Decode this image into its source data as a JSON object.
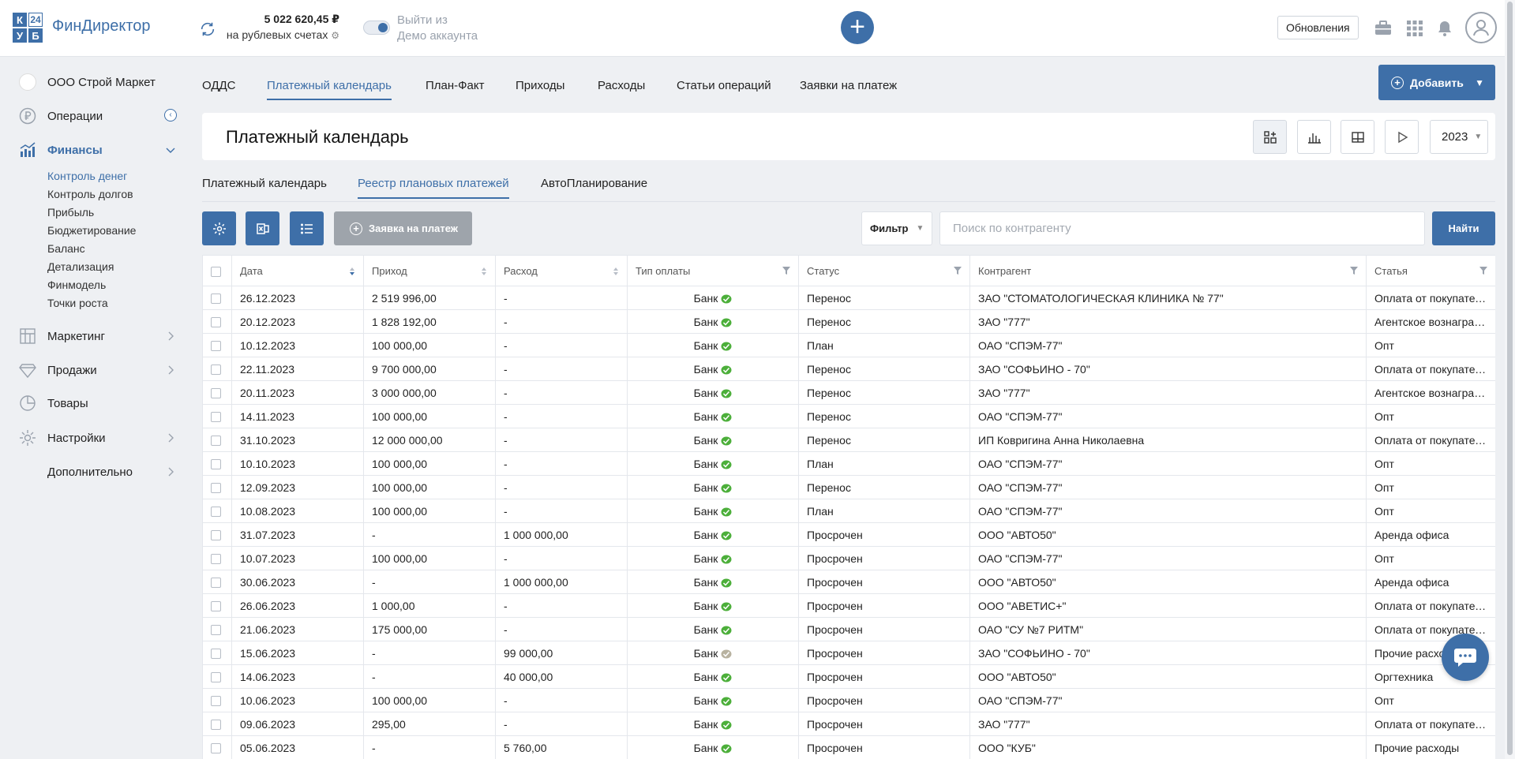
{
  "header": {
    "logo_cells": [
      "К",
      "24",
      "У",
      "Б"
    ],
    "app_title": "ФинДиректор",
    "balance_amount": "5 022 620,45 ₽",
    "balance_sub": "на рублевых счетах",
    "demo_line1": "Выйти из",
    "demo_line2": "Демо аккаунта",
    "updates_label": "Обновления",
    "add_symbol": "+"
  },
  "sidebar": {
    "company": "ООО Строй Маркет",
    "items": [
      {
        "label": "Операции",
        "icon": "ruble-icon"
      },
      {
        "label": "Финансы",
        "icon": "chart-icon",
        "active": true
      },
      {
        "label": "Маркетинг",
        "icon": "grid-icon"
      },
      {
        "label": "Продажи",
        "icon": "diamond-icon"
      },
      {
        "label": "Товары",
        "icon": "pie-icon"
      },
      {
        "label": "Настройки",
        "icon": "gear-icon"
      },
      {
        "label": "Дополнительно",
        "icon": ""
      }
    ],
    "finance_sub": [
      "Контроль денег",
      "Контроль долгов",
      "Прибыль",
      "Бюджетирование",
      "Баланс",
      "Детализация",
      "Финмодель",
      "Точки роста"
    ]
  },
  "tabs": [
    "ОДДС",
    "Платежный календарь",
    "План-Факт",
    "Приходы",
    "Расходы",
    "Статьи операций",
    "Заявки на платеж"
  ],
  "add_button": "Добавить",
  "page_title": "Платежный календарь",
  "year": "2023",
  "sub_tabs": [
    "Платежный календарь",
    "Реестр плановых платежей",
    "АвтоПланирование"
  ],
  "toolbar": {
    "request_label": "Заявка на платеж",
    "filter_label": "Фильтр",
    "search_placeholder": "Поиск по контрагенту",
    "find_label": "Найти"
  },
  "table": {
    "columns": [
      "Дата",
      "Приход",
      "Расход",
      "Тип оплаты",
      "Статус",
      "Контрагент",
      "Статья"
    ],
    "rows": [
      [
        "26.12.2023",
        "2 519 996,00",
        "-",
        "Банк",
        "Перенос",
        "ЗАО \"СТОМАТОЛОГИЧЕСКАЯ КЛИНИКА № 77\"",
        "Оплата от покупателей"
      ],
      [
        "20.12.2023",
        "1 828 192,00",
        "-",
        "Банк",
        "Перенос",
        "ЗАО \"777\"",
        "Агентское вознаграждение"
      ],
      [
        "10.12.2023",
        "100 000,00",
        "-",
        "Банк",
        "План",
        "ОАО \"СПЭМ-77\"",
        "Опт"
      ],
      [
        "22.11.2023",
        "9 700 000,00",
        "-",
        "Банк",
        "Перенос",
        "ЗАО \"СОФЬИНО - 70\"",
        "Оплата от покупателей"
      ],
      [
        "20.11.2023",
        "3 000 000,00",
        "-",
        "Банк",
        "Перенос",
        "ЗАО \"777\"",
        "Агентское вознаграждение"
      ],
      [
        "14.11.2023",
        "100 000,00",
        "-",
        "Банк",
        "Перенос",
        "ОАО \"СПЭМ-77\"",
        "Опт"
      ],
      [
        "31.10.2023",
        "12 000 000,00",
        "-",
        "Банк",
        "Перенос",
        "ИП Ковригина Анна Николаевна",
        "Оплата от покупателей"
      ],
      [
        "10.10.2023",
        "100 000,00",
        "-",
        "Банк",
        "План",
        "ОАО \"СПЭМ-77\"",
        "Опт"
      ],
      [
        "12.09.2023",
        "100 000,00",
        "-",
        "Банк",
        "Перенос",
        "ОАО \"СПЭМ-77\"",
        "Опт"
      ],
      [
        "10.08.2023",
        "100 000,00",
        "-",
        "Банк",
        "План",
        "ОАО \"СПЭМ-77\"",
        "Опт"
      ],
      [
        "31.07.2023",
        "-",
        "1 000 000,00",
        "Банк",
        "Просрочен",
        "ООО \"АВТО50\"",
        "Аренда офиса"
      ],
      [
        "10.07.2023",
        "100 000,00",
        "-",
        "Банк",
        "Просрочен",
        "ОАО \"СПЭМ-77\"",
        "Опт"
      ],
      [
        "30.06.2023",
        "-",
        "1 000 000,00",
        "Банк",
        "Просрочен",
        "ООО \"АВТО50\"",
        "Аренда офиса"
      ],
      [
        "26.06.2023",
        "1 000,00",
        "-",
        "Банк",
        "Просрочен",
        "ООО \"АВЕТИС+\"",
        "Оплата от покупателей"
      ],
      [
        "21.06.2023",
        "175 000,00",
        "-",
        "Банк",
        "Просрочен",
        "ОАО \"СУ №7 РИТМ\"",
        "Оплата от покупателей"
      ],
      [
        "15.06.2023",
        "-",
        "99 000,00",
        "Банк",
        "Просрочен",
        "ЗАО \"СОФЬИНО - 70\"",
        "Прочие расходы"
      ],
      [
        "14.06.2023",
        "-",
        "40 000,00",
        "Банк",
        "Просрочен",
        "ООО \"АВТО50\"",
        "Оргтехника"
      ],
      [
        "10.06.2023",
        "100 000,00",
        "-",
        "Банк",
        "Просрочен",
        "ОАО \"СПЭМ-77\"",
        "Опт"
      ],
      [
        "09.06.2023",
        "295,00",
        "-",
        "Банк",
        "Просрочен",
        "ЗАО \"777\"",
        "Оплата от покупателей"
      ],
      [
        "05.06.2023",
        "-",
        "5 760,00",
        "Банк",
        "Просрочен",
        "ООО \"КУБ\"",
        "Прочие расходы"
      ]
    ],
    "pay_icon_colors": [
      "green",
      "green",
      "green",
      "green",
      "green",
      "green",
      "green",
      "green",
      "green",
      "green",
      "green",
      "green",
      "green",
      "green",
      "green",
      "grey",
      "green",
      "green",
      "green",
      "green"
    ]
  },
  "colors": {
    "accent": "#3e6fa8",
    "pay_green": "#4caf3a",
    "pay_grey": "#b8b2a0"
  }
}
